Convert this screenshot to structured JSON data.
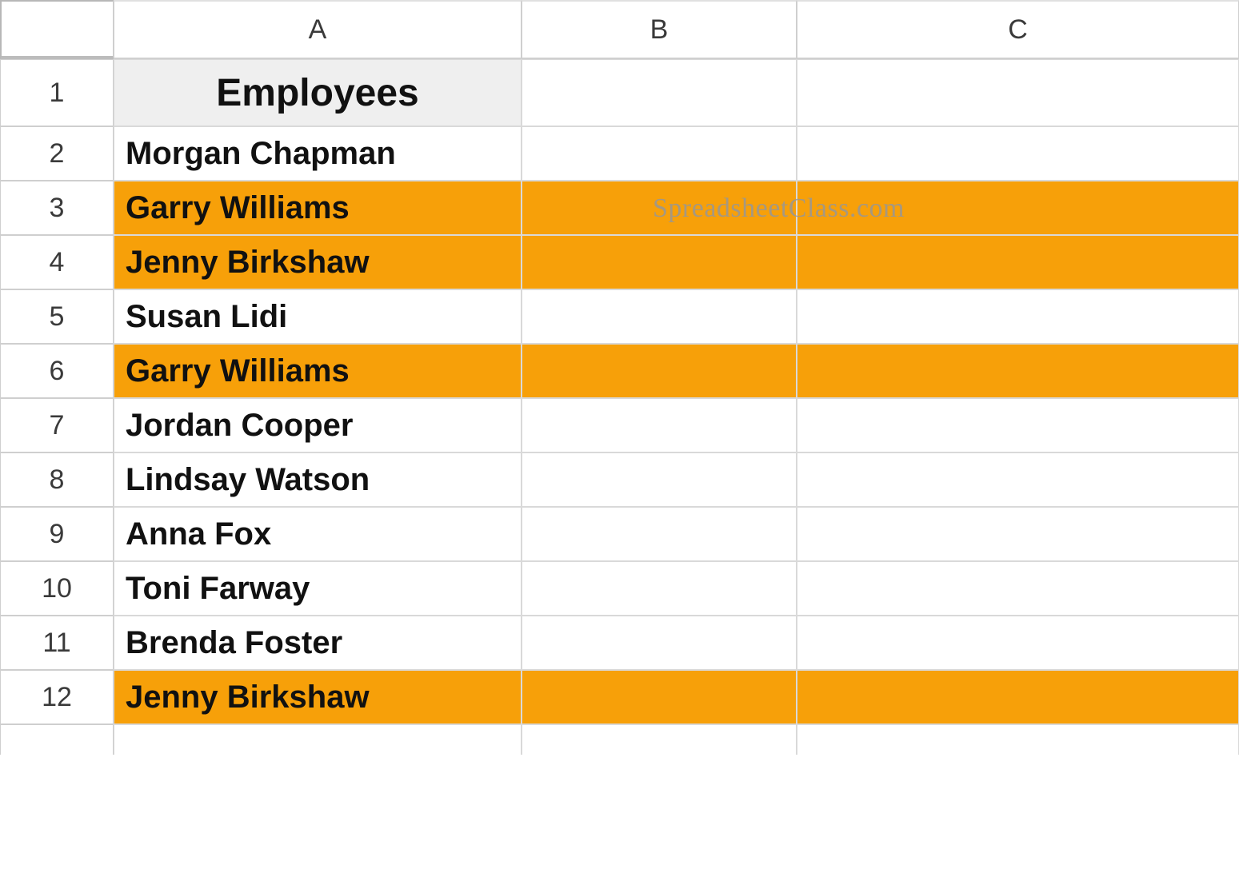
{
  "columns": [
    "A",
    "B",
    "C"
  ],
  "rows": {
    "1": {
      "num": "1",
      "a": "Employees",
      "header": true,
      "highlight": false
    },
    "2": {
      "num": "2",
      "a": "Morgan Chapman",
      "header": false,
      "highlight": false
    },
    "3": {
      "num": "3",
      "a": "Garry Williams",
      "header": false,
      "highlight": true
    },
    "4": {
      "num": "4",
      "a": "Jenny Birkshaw",
      "header": false,
      "highlight": true
    },
    "5": {
      "num": "5",
      "a": "Susan Lidi",
      "header": false,
      "highlight": false
    },
    "6": {
      "num": "6",
      "a": "Garry Williams",
      "header": false,
      "highlight": true
    },
    "7": {
      "num": "7",
      "a": "Jordan Cooper",
      "header": false,
      "highlight": false
    },
    "8": {
      "num": "8",
      "a": "Lindsay Watson",
      "header": false,
      "highlight": false
    },
    "9": {
      "num": "9",
      "a": "Anna Fox",
      "header": false,
      "highlight": false
    },
    "10": {
      "num": "10",
      "a": "Toni Farway",
      "header": false,
      "highlight": false
    },
    "11": {
      "num": "11",
      "a": "Brenda Foster",
      "header": false,
      "highlight": false
    },
    "12": {
      "num": "12",
      "a": "Jenny Birkshaw",
      "header": false,
      "highlight": true
    }
  },
  "watermark": "SpreadsheetClass.com",
  "highlight_color": "#f7a009"
}
